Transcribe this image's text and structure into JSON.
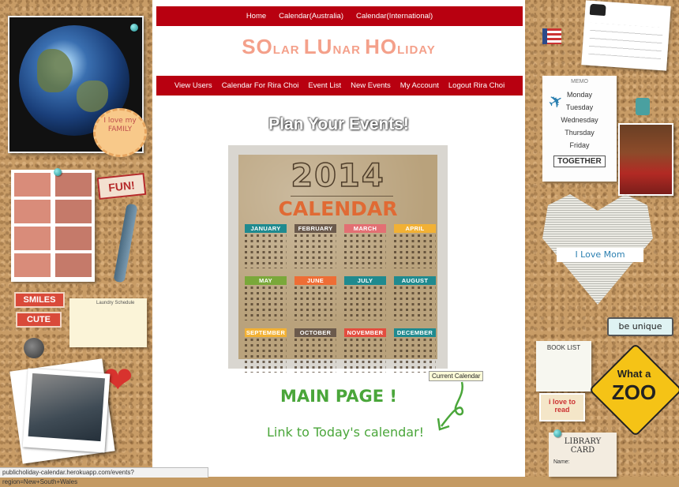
{
  "top_nav": {
    "home": "Home",
    "cal_au": "Calendar(Australia)",
    "cal_intl": "Calendar(International)"
  },
  "logo": {
    "p1_big": "SO",
    "p1_small": "LAR ",
    "p2_big": "LU",
    "p2_small": "NAR ",
    "p3_big": "HO",
    "p3_small": "LIDAY"
  },
  "sub_nav": {
    "view_users": "View Users",
    "calendar_for": "Calendar For Rira Choi",
    "event_list": "Event List",
    "new_events": "New Events",
    "my_account": "My Account",
    "logout": "Logout Rira Choi"
  },
  "heading": "Plan Your Events!",
  "calendar_image": {
    "year": "2014",
    "title": "CALENDAR",
    "months": [
      {
        "name": "JANUARY",
        "color": "#1f8a8f"
      },
      {
        "name": "FEBRUARY",
        "color": "#6b5a4c"
      },
      {
        "name": "MARCH",
        "color": "#e36f73"
      },
      {
        "name": "APRIL",
        "color": "#f2b134"
      },
      {
        "name": "MAY",
        "color": "#7aa83a"
      },
      {
        "name": "JUNE",
        "color": "#ee6d35"
      },
      {
        "name": "JULY",
        "color": "#1f8a8f"
      },
      {
        "name": "AUGUST",
        "color": "#1f8a8f"
      },
      {
        "name": "SEPTEMBER",
        "color": "#f2b134"
      },
      {
        "name": "OCTOBER",
        "color": "#6b5a4c"
      },
      {
        "name": "NOVEMBER",
        "color": "#e34d3f"
      },
      {
        "name": "DECEMBER",
        "color": "#1f8a8f"
      }
    ]
  },
  "main_page_link": "MAIN PAGE !",
  "today_link": "Link to Today's calendar!",
  "tooltip": "Current Calendar",
  "status_url": "publicholiday-calendar.herokuapp.com/events?region=New+South+Wales",
  "decor": {
    "love_family": "I love my FAMILY",
    "fun": "FUN!",
    "smiles": "SMILES",
    "cute": "CUTE",
    "laundry": "Laundry Schedule",
    "memo": "MEMO",
    "memo_days": [
      "Monday",
      "Tuesday",
      "Wednesday",
      "Thursday",
      "Friday"
    ],
    "together": "TOGETHER",
    "i_love_mom": "I Love Mom",
    "be_unique": "be unique",
    "book_list": "BOOK LIST",
    "what_a_zoo_1": "What a",
    "what_a_zoo_2": "ZOO",
    "i_love_to_read": "i love to read",
    "library_card": "LIBRARY CARD",
    "name_label": "Name:"
  },
  "colors": {
    "nav_red": "#b80010",
    "logo_pink": "#f4a08a",
    "link_green": "#4aa63a"
  }
}
